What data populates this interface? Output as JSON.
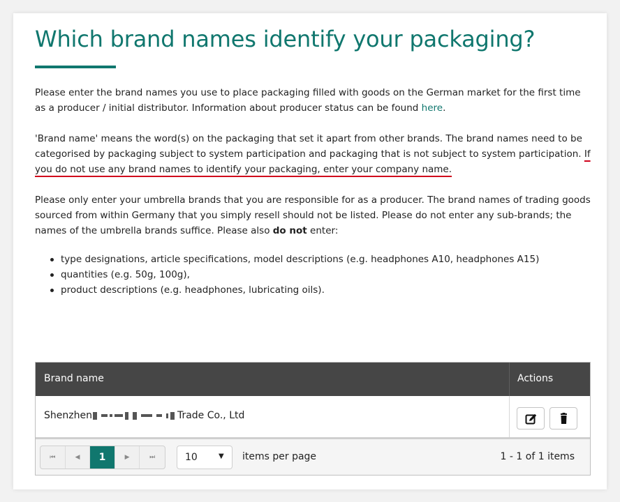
{
  "page": {
    "title": "Which brand names identify your packaging?",
    "accent_color": "#10776e",
    "highlight_color": "#d0021b"
  },
  "intro": {
    "p1_text": "Please enter the brand names you use to place packaging filled with goods on the German market for the first time as a producer / initial distributor. Information about producer status can be found ",
    "p1_link": "here",
    "p1_end": ".",
    "p2_text": "'Brand name' means the word(s) on the packaging that set it apart from other brands. The brand names need to be categorised by packaging subject to system participation and packaging that is not subject to system participation. ",
    "p2_highlight": "If you do not use any brand names to identify your packaging, enter your company name.",
    "p3_text": "Please only enter your umbrella brands that you are responsible for as a producer. The brand names of trading goods sourced from within Germany that you simply resell should not be listed. Please do not enter any sub-brands; the names of the umbrella brands suffice. Please also ",
    "p3_bold": "do not",
    "p3_end": " enter:",
    "bullets": [
      "type designations, article specifications, model descriptions (e.g. headphones A10, headphones A15)",
      "quantities (e.g. 50g, 100g),",
      "product descriptions (e.g. headphones, lubricating oils)."
    ]
  },
  "grid": {
    "columns": {
      "brand": "Brand name",
      "actions": "Actions"
    },
    "rows": [
      {
        "brand_prefix": "Shenzhen",
        "brand_suffix": "Trade Co., Ltd",
        "edit_icon": "edit-icon",
        "delete_icon": "trash-icon"
      }
    ],
    "pager": {
      "first_icon": "first-page-icon",
      "prev_icon": "prev-page-icon",
      "current_page": "1",
      "next_icon": "next-page-icon",
      "last_icon": "last-page-icon",
      "page_size": "10",
      "page_size_arrow": "▼",
      "items_per_page_label": "items per page",
      "info": "1 - 1 of 1 items"
    }
  }
}
